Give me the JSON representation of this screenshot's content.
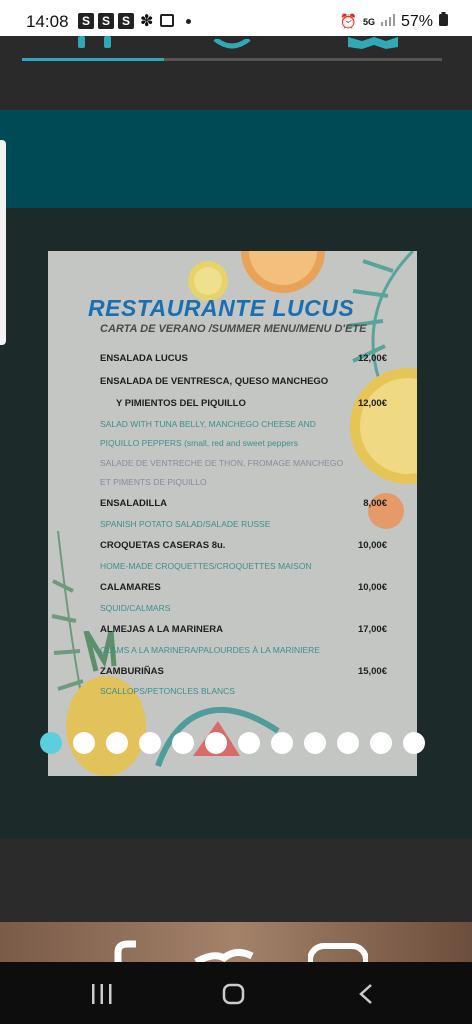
{
  "status_bar": {
    "time": "14:08",
    "notification_icons": [
      "S",
      "S",
      "S"
    ],
    "battery": "57%",
    "network": "5G"
  },
  "colors": {
    "accent": "#2ea9b5",
    "teal_band": "#004a56",
    "title_blue": "#1a6fb0",
    "dot_active": "#5ad0dc"
  },
  "menu": {
    "title": "RESTAURANTE LUCUS",
    "subtitle": "CARTA DE VERANO /SUMMER MENU/MENU D'ETE",
    "items": [
      {
        "name": "ENSALADA LUCUS",
        "price": "12,00€"
      },
      {
        "name": "ENSALADA DE VENTRESCA, QUESO MANCHEGO"
      },
      {
        "name": "Y PIMIENTOS DEL PIQUILLO",
        "price": "12,00€"
      },
      {
        "name": "SALAD WITH TUNA BELLY, MANCHEGO CHEESE AND"
      },
      {
        "name": "PIQUILLO PEPPERS (small, red and sweet peppers"
      },
      {
        "name": "SALADE DE VENTRECHE DE THON, FROMAGE MANCHEGO"
      },
      {
        "name": "ET PIMENTS DE PIQUILLO"
      },
      {
        "name": "ENSALADILLA",
        "price": "8,00€"
      },
      {
        "name": "SPANISH POTATO SALAD/SALADE RUSSE"
      },
      {
        "name": "CROQUETAS CASERAS 8u.",
        "price": "10,00€"
      },
      {
        "name": "HOME-MADE CROQUETTES/CROQUETTES MAISON"
      },
      {
        "name": "CALAMARES",
        "price": "10,00€"
      },
      {
        "name": "SQUID/CALMARS"
      },
      {
        "name": "ALMEJAS A LA MARINERA",
        "price": "17,00€"
      },
      {
        "name": "CLAMS A LA MARINERA/PALOURDES À LA MARINIERE"
      },
      {
        "name": "ZAMBURIÑAS",
        "price": "15,00€"
      },
      {
        "name": "SCALLOPS/PETONCLES BLANCS"
      }
    ]
  },
  "carousel": {
    "total_slides": 12,
    "current_slide": 1
  },
  "icons": [
    "cutlery-icon",
    "clock-icon",
    "map-icon",
    "facebook-icon",
    "twitter-icon",
    "instagram-icon",
    "recent-apps-icon",
    "home-icon",
    "back-icon"
  ]
}
